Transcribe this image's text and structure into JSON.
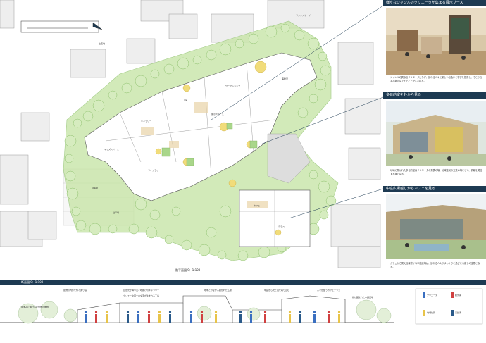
{
  "plan": {
    "title": "一階平面図 S：1:100",
    "street_labels": [
      "ランドスケープ",
      "駐車場",
      "住宅地"
    ],
    "room_labels": [
      "キッズスペース",
      "ギャラリー",
      "カフェ",
      "工房",
      "ワークショップ",
      "展示スペース",
      "事務室",
      "駐車場",
      "ライブラリー",
      "テラス"
    ]
  },
  "panel": {
    "sections": [
      {
        "title": "様々なジャンルのクリエータが集まる展示ブース",
        "desc": "ジャンルの異なるクリエータたちが、訪れる人々に新しい出会いと学びを提供し、そこからまた新たなアイディアが生まれる。"
      },
      {
        "title": "多目的室を外から見る",
        "desc": "地域に開かれた多目的室はクリエータの発表の場、地域住民の交流の場として、情報を発信する場となる。"
      },
      {
        "title": "中庭広場越しからカフェを見る",
        "desc": "カフェから見える緑豊かな中庭広場は、訪れる人々がゆっくりと過ごせる癒しの空間となる。"
      }
    ]
  },
  "section": {
    "title": "断面図 S：1:100",
    "callouts": [
      "建物の内外を繋ぐ通り庭",
      "自然光が降り注ぐ吹抜けのギャラリー",
      "クリエータ同士の交流が生まれる工房",
      "地域とつながる開かれた広場",
      "中庭から光と風を取り込む",
      "人々が集うカフェテラス",
      "緑に囲まれた中庭広場",
      "街並みに溶け込む低層の屋根"
    ],
    "legend": [
      "クリエータ",
      "観光客",
      "地域住民",
      "来館者"
    ]
  },
  "colors": {
    "navy": "#1d3a52",
    "tree_green": "#c8e5a8",
    "tree_stroke": "#8bbf6a",
    "accent_yellow": "#e8c44a",
    "accent_red": "#d04040",
    "accent_blue": "#3a6fc0"
  }
}
